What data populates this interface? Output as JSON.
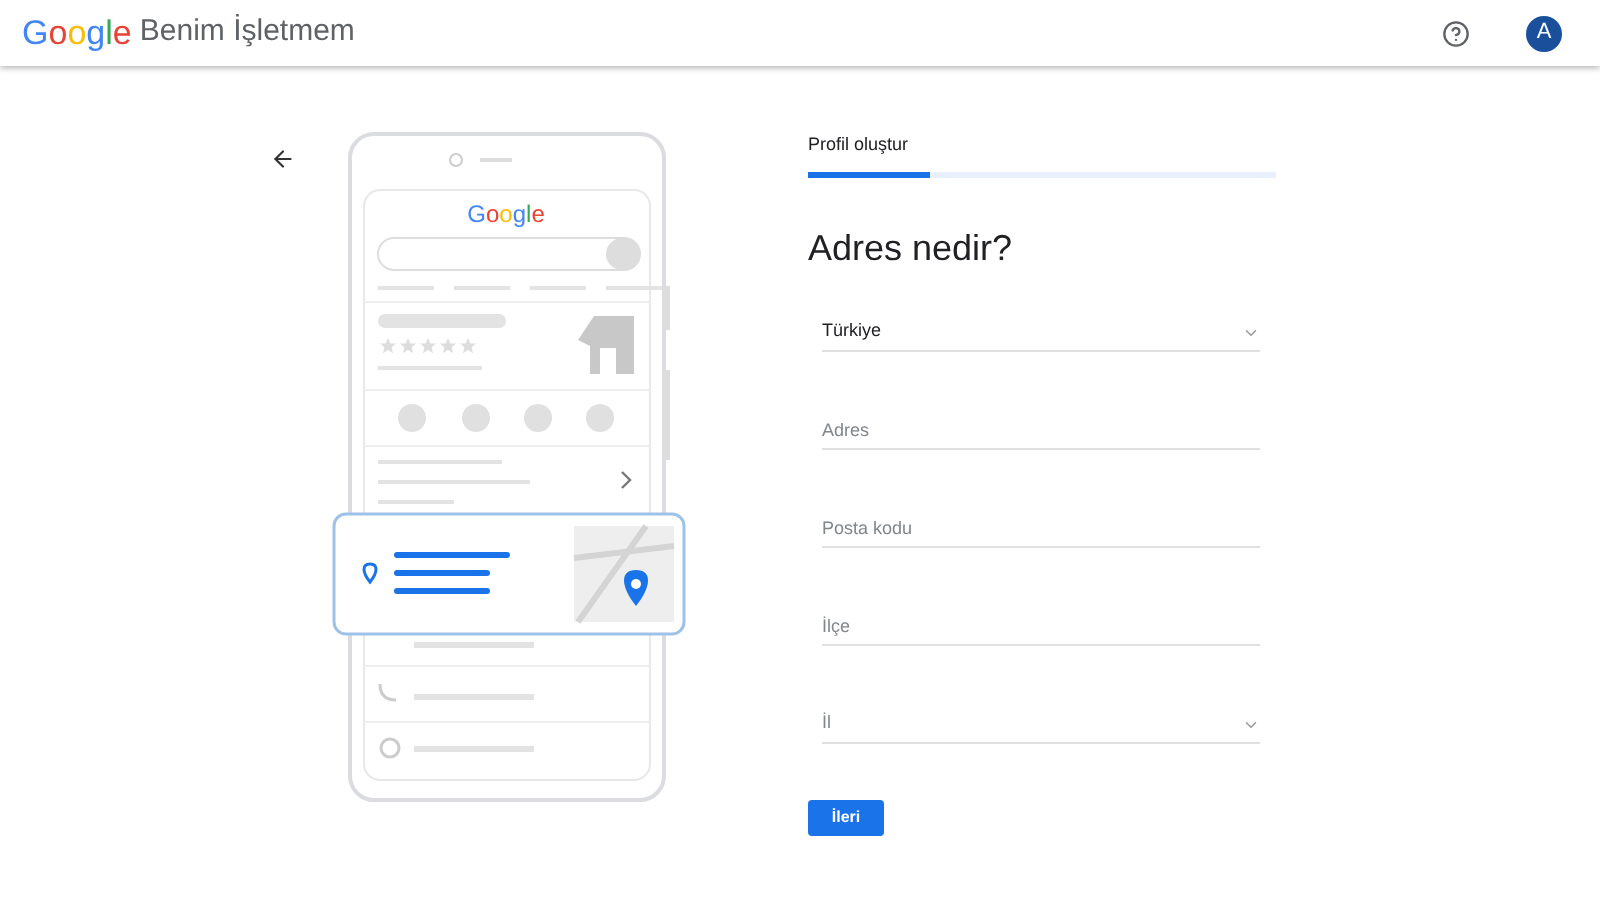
{
  "header": {
    "logo": "Google",
    "product": "Benim İşletmem",
    "avatar": "A"
  },
  "illustration": {
    "logo": "Google"
  },
  "progress": {
    "label": "Profil oluştur",
    "level": 0.26
  },
  "title": "Adres nedir?",
  "fields": [
    {
      "kind": "select",
      "value": "Türkiye"
    },
    {
      "kind": "text",
      "placeholder": "Adres"
    },
    {
      "kind": "text",
      "placeholder": "Posta kodu"
    },
    {
      "kind": "text",
      "placeholder": "İlçe"
    },
    {
      "kind": "select",
      "placeholder": "İl"
    }
  ],
  "next_button": "İleri"
}
